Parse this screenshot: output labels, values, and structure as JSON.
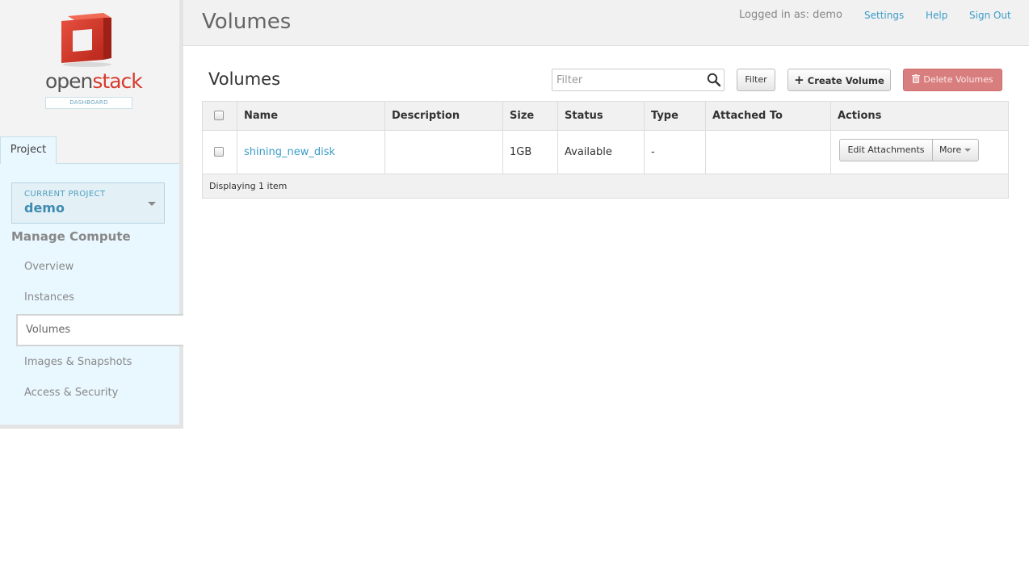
{
  "logo": {
    "word_open": "open",
    "word_stack": "stack",
    "sub": "DASHBOARD"
  },
  "sidebar": {
    "tab": "Project",
    "project_select": {
      "caption": "CURRENT PROJECT",
      "value": "demo"
    },
    "heading": "Manage Compute",
    "items": [
      {
        "label": "Overview",
        "active": false
      },
      {
        "label": "Instances",
        "active": false
      },
      {
        "label": "Volumes",
        "active": true
      },
      {
        "label": "Images & Snapshots",
        "active": false
      },
      {
        "label": "Access & Security",
        "active": false
      }
    ]
  },
  "header": {
    "title": "Volumes",
    "logged_in": "Logged in as: demo",
    "links": {
      "settings": "Settings",
      "help": "Help",
      "sign_out": "Sign Out"
    }
  },
  "main": {
    "title": "Volumes",
    "filter": {
      "placeholder": "Filter",
      "button": "Filter"
    },
    "create_button": "Create Volume",
    "delete_button": "Delete Volumes",
    "table": {
      "columns": [
        "Name",
        "Description",
        "Size",
        "Status",
        "Type",
        "Attached To",
        "Actions"
      ],
      "rows": [
        {
          "name": "shining_new_disk",
          "description": "",
          "size": "1GB",
          "status": "Available",
          "type": "-",
          "attached_to": ""
        }
      ],
      "row_actions": {
        "edit": "Edit Attachments",
        "more": "More"
      },
      "footer": "Displaying 1 item"
    }
  },
  "colors": {
    "accent_link": "#3b9cc9",
    "danger": "#d97e7e",
    "brand_red": "#d63a2c"
  },
  "icons": [
    "openstack-logo",
    "chevron-down-icon",
    "search-icon",
    "plus-icon",
    "trash-icon"
  ]
}
